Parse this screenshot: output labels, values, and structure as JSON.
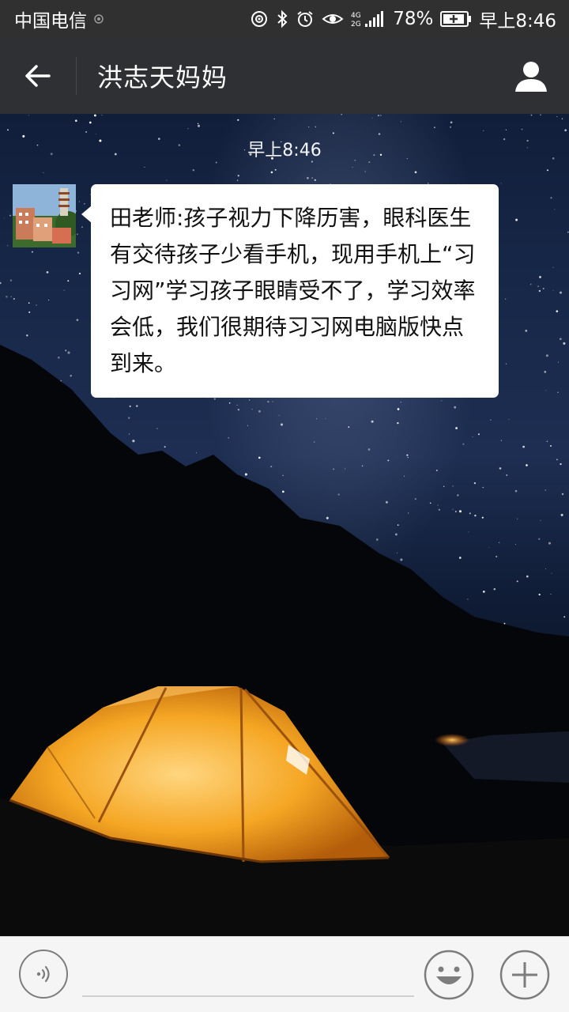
{
  "status_bar": {
    "carrier": "中国电信",
    "battery_percent": "78%",
    "time": "早上8:46",
    "icons": [
      "carrier-signal-icon",
      "nfc-icon",
      "bluetooth-icon",
      "alarm-icon",
      "eye-icon",
      "network-4g-icon",
      "battery-charging-icon"
    ]
  },
  "header": {
    "title": "洪志天妈妈",
    "back_icon": "arrow-left-icon",
    "profile_icon": "person-icon"
  },
  "chat": {
    "timestamp": "早上8:46",
    "messages": [
      {
        "direction": "incoming",
        "avatar_icon": "building-avatar",
        "text": "田老师:孩子视力下降历害，眼科医生有交待孩子少看手机，现用手机上“习习网”学习孩子眼睛受不了，学习效率会低，我们很期待习习网电脑版快点到来。"
      }
    ]
  },
  "input_bar": {
    "value": "",
    "voice_icon": "voice-icon",
    "emoji_icon": "emoji-icon",
    "plus_icon": "plus-icon"
  },
  "colors": {
    "title_bar": "#2f3033",
    "status_bar": "#303030",
    "bubble": "#ffffff",
    "input_bar": "#f5f5f6",
    "tent": "#f5a623"
  }
}
